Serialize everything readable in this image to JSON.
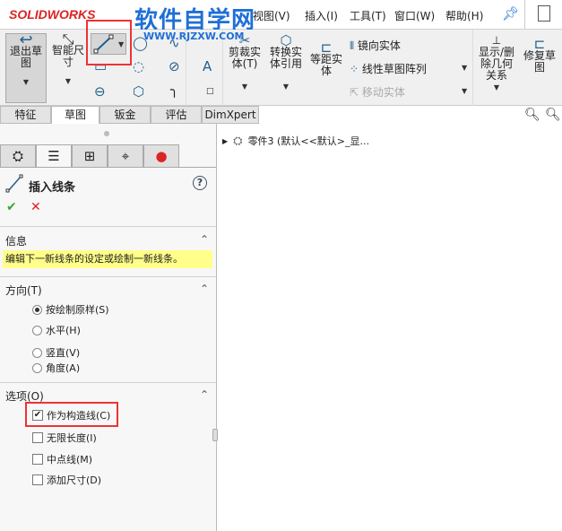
{
  "app": {
    "logo": "SOLIDWORKS",
    "watermark": "软件自学网",
    "watermark_url": "WWW.RJZXW.COM"
  },
  "menu": [
    "视图(V)",
    "插入(I)",
    "工具(T)",
    "窗口(W)",
    "帮助(H)"
  ],
  "ribbon": {
    "exit_sketch": "退出草图",
    "smart_dim": "智能尺寸",
    "trim": "剪裁实体(T)",
    "convert": "转换实体引用",
    "offset": "等距实体",
    "mirror": "镜向实体",
    "linear_pattern": "线性草图阵列",
    "move": "移动实体",
    "show_delete": "显示/删除几何关系",
    "repair": "修复草图"
  },
  "tabs": [
    "特征",
    "草图",
    "钣金",
    "评估",
    "DimXpert"
  ],
  "tree": {
    "item": "零件3 (默认<<默认>_显..."
  },
  "panel": {
    "title": "插入线条",
    "info_header": "信息",
    "info_text": "编辑下一新线条的设定或绘制一新线条。",
    "direction_header": "方向(T)",
    "directions": [
      {
        "label": "按绘制原样(S)",
        "selected": true
      },
      {
        "label": "水平(H)",
        "selected": false
      },
      {
        "label": "竖直(V)",
        "selected": false
      },
      {
        "label": "角度(A)",
        "selected": false
      }
    ],
    "options_header": "选项(O)",
    "options": [
      {
        "label": "作为构造线(C)",
        "checked": true
      },
      {
        "label": "无限长度(I)",
        "checked": false
      },
      {
        "label": "中点线(M)",
        "checked": false
      },
      {
        "label": "添加尺寸(D)",
        "checked": false
      }
    ]
  }
}
